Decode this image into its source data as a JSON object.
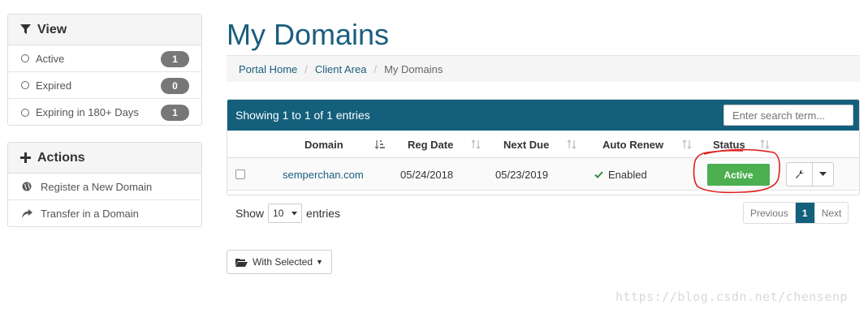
{
  "sidebar": {
    "view": {
      "title": "View",
      "icon": "filter-icon",
      "items": [
        {
          "label": "Active",
          "count": "1"
        },
        {
          "label": "Expired",
          "count": "0"
        },
        {
          "label": "Expiring in 180+ Days",
          "count": "1"
        }
      ]
    },
    "actions": {
      "title": "Actions",
      "icon": "plus-icon",
      "items": [
        {
          "label": "Register a New Domain",
          "icon": "globe-icon"
        },
        {
          "label": "Transfer in a Domain",
          "icon": "share-arrow-icon"
        }
      ]
    }
  },
  "page": {
    "title": "My Domains"
  },
  "breadcrumb": {
    "items": [
      "Portal Home",
      "Client Area",
      "My Domains"
    ],
    "separator": "/"
  },
  "table": {
    "info": "Showing 1 to 1 of 1 entries",
    "search_placeholder": "Enter search term...",
    "columns": [
      "Domain",
      "Reg Date",
      "Next Due",
      "Auto Renew",
      "Status"
    ],
    "rows": [
      {
        "domain": "semperchan.com",
        "reg_date": "05/24/2018",
        "next_due": "05/23/2019",
        "auto_renew": "Enabled",
        "status": "Active"
      }
    ]
  },
  "length_menu": {
    "prefix": "Show",
    "value": "10",
    "suffix": "entries"
  },
  "pagination": {
    "previous": "Previous",
    "current": "1",
    "next": "Next"
  },
  "bulk_action": {
    "label": "With Selected"
  },
  "watermark": "https://blog.csdn.net/chensenp",
  "colors": {
    "brand": "#135f7c",
    "link": "#1a5e7e",
    "status_active": "#4caf50",
    "annotation": "#e02020"
  }
}
